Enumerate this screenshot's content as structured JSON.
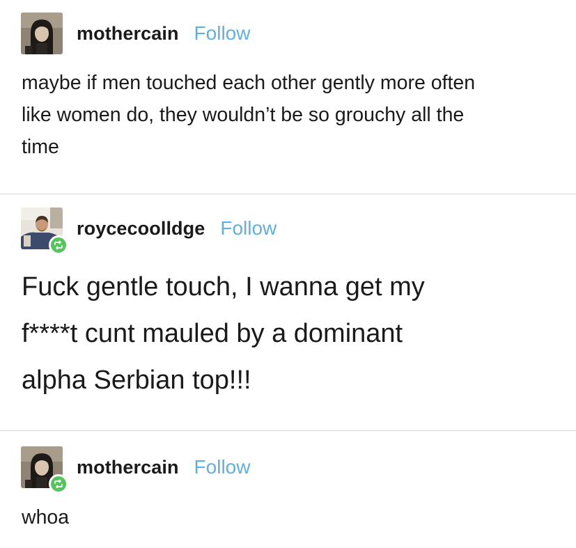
{
  "posts": [
    {
      "username": "mothercain",
      "follow_label": "Follow",
      "avatar_icon": "user-avatar-dark-hair",
      "text": "maybe if men touched each other gently more often\nlike women do, they wouldn’t be so grouchy all the\ntime"
    },
    {
      "username": "roycecoolldge",
      "follow_label": "Follow",
      "avatar_icon": "user-avatar-bearded-man",
      "reblog_icon": "reblog-icon",
      "text": "Fuck gentle touch, I wanna get my\nf****t cunt mauled by a dominant\nalpha Serbian top!!!"
    },
    {
      "username": "mothercain",
      "follow_label": "Follow",
      "avatar_icon": "user-avatar-dark-hair",
      "reblog_icon": "reblog-icon",
      "text": "whoa"
    }
  ],
  "colors": {
    "follow": "#5fb0de",
    "reblog_badge": "#56c35f",
    "divider": "#d6d6d6",
    "text": "#1a1a1a"
  }
}
